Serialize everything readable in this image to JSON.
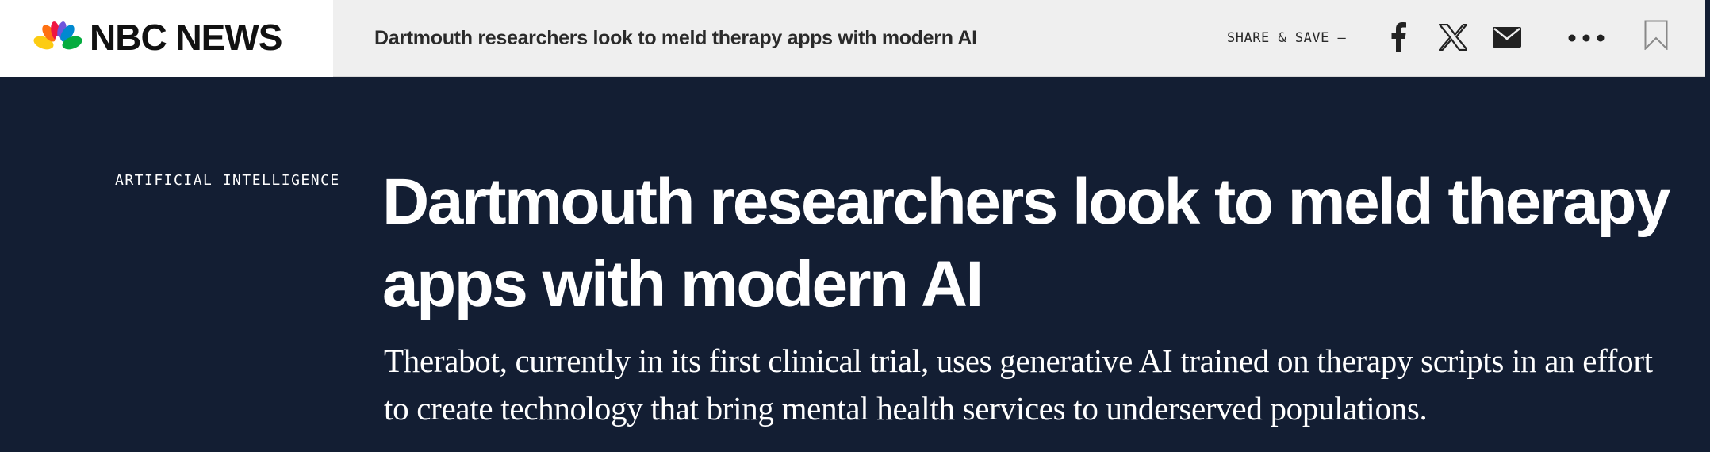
{
  "brand": {
    "name": "NBC NEWS",
    "logo_icon": "nbc-peacock-icon",
    "peacock_colors": [
      "#fccc12",
      "#ef1541",
      "#6e55dc",
      "#0089d0",
      "#05ac3f",
      "#ff7112"
    ]
  },
  "topbar": {
    "title": "Dartmouth researchers look to meld therapy apps with modern AI",
    "share_label": "SHARE & SAVE —",
    "actions": [
      {
        "name": "facebook-share",
        "icon": "facebook-icon"
      },
      {
        "name": "x-share",
        "icon": "x-icon"
      },
      {
        "name": "email-share",
        "icon": "mail-icon"
      },
      {
        "name": "more-options",
        "icon": "more-dots-icon"
      },
      {
        "name": "save-bookmark",
        "icon": "bookmark-icon"
      }
    ]
  },
  "article": {
    "section": "ARTIFICIAL INTELLIGENCE",
    "headline": "Dartmouth researchers look to meld therapy apps with modern AI",
    "dek": "Therabot, currently in its first clinical trial, uses generative AI trained on therapy scripts in an effort to create technology that bring mental health services to underserved populations."
  },
  "colors": {
    "hero_background": "#131e33",
    "topbar_background": "#efefef",
    "text_light": "#ffffff",
    "text_dark": "#111111"
  }
}
